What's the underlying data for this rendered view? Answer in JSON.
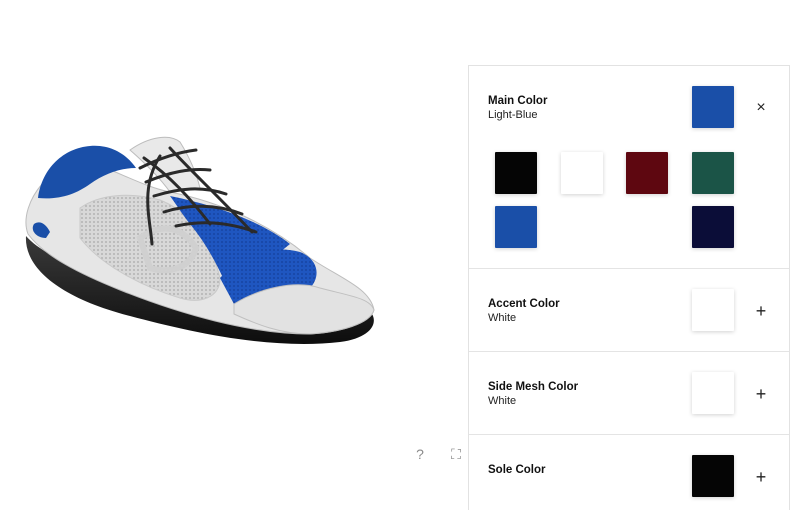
{
  "viewer": {
    "help_icon": "question-mark-icon",
    "fullscreen_icon": "fullscreen-icon",
    "help_glyph": "?",
    "fullscreen_glyph": "⛶"
  },
  "colors": {
    "light_blue": "#1a4fa8",
    "white": "#ffffff",
    "black": "#050505",
    "burgundy": "#5e0710",
    "dark_green": "#1b5447",
    "navy": "#0b0d38"
  },
  "sections": [
    {
      "title": "Main Color",
      "value": "Light-Blue",
      "swatch": "#1a4fa8",
      "action": "×",
      "expanded": true,
      "options": [
        {
          "name": "Black",
          "color": "#050505"
        },
        {
          "name": "White",
          "color": "#ffffff"
        },
        {
          "name": "Burgundy",
          "color": "#5e0710"
        },
        {
          "name": "Dark-Green",
          "color": "#1b5447"
        },
        {
          "name": "Light-Blue",
          "color": "#1a4fa8"
        },
        {
          "name": "Navy",
          "color": "#0b0d38"
        }
      ]
    },
    {
      "title": "Accent Color",
      "value": "White",
      "swatch": "#ffffff",
      "action": "+"
    },
    {
      "title": "Side Mesh Color",
      "value": "White",
      "swatch": "#ffffff",
      "action": "+"
    },
    {
      "title": "Sole Color",
      "value": "",
      "swatch": "#050505",
      "action": "+"
    }
  ]
}
